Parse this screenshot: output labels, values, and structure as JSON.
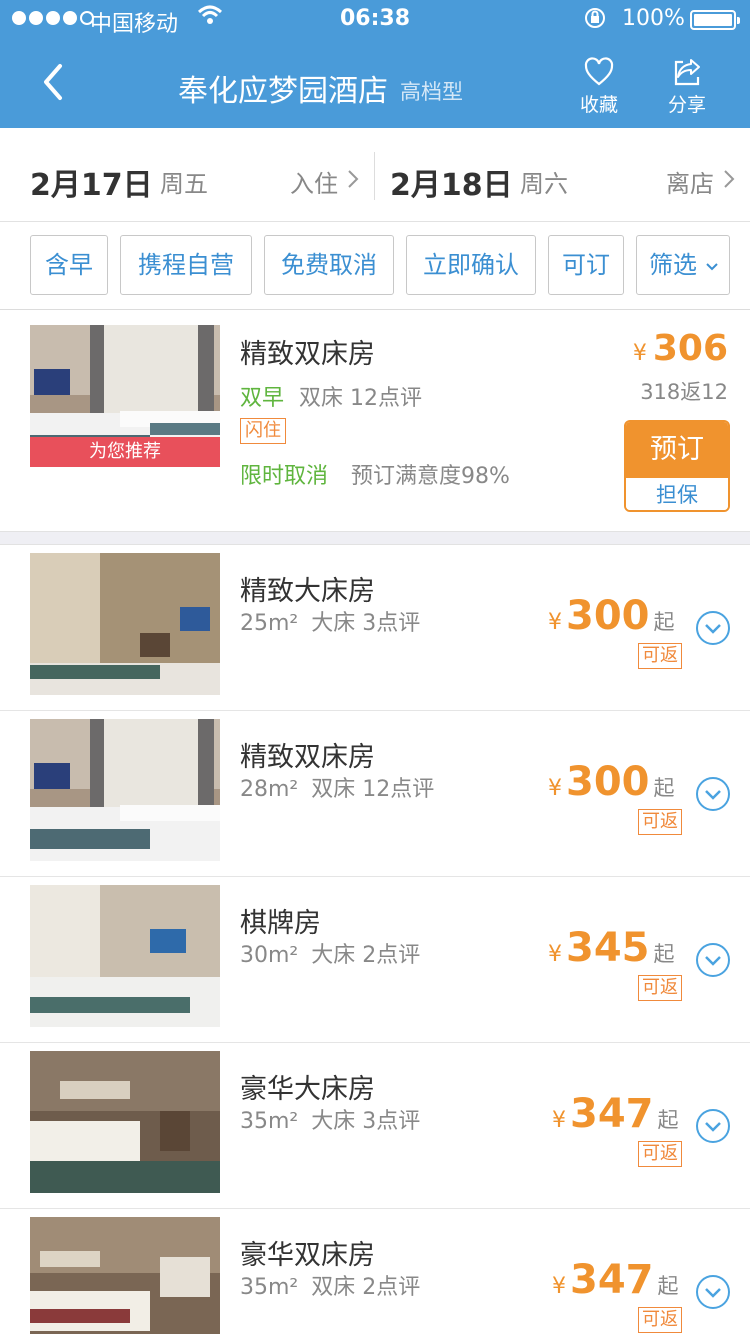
{
  "status": {
    "carrier": "中国移动",
    "time": "06:38",
    "battery": "100%"
  },
  "nav": {
    "title": "奉化应梦园酒店",
    "tag": "高档型",
    "favorite": "收藏",
    "share": "分享"
  },
  "dates": {
    "checkin_date": "2月17日",
    "checkin_week": "周五",
    "checkin_action": "入住",
    "checkout_date": "2月18日",
    "checkout_week": "周六",
    "checkout_action": "离店"
  },
  "filters": [
    "含早",
    "携程自营",
    "免费取消",
    "立即确认",
    "可订",
    "筛选"
  ],
  "featured": {
    "name": "精致双床房",
    "breakfast": "双早",
    "info": "双床 12点评",
    "flash": "闪住",
    "cancel": "限时取消",
    "satisfaction": "预订满意度98%",
    "yen": "¥",
    "price": "306",
    "cashback": "318返12",
    "book": "预订",
    "guarantee": "担保",
    "badge": "为您推荐"
  },
  "rooms": [
    {
      "name": "精致大床房",
      "area": "25m²",
      "info": "大床 3点评",
      "yen": "¥",
      "price": "300",
      "qi": "起",
      "fan": "可返"
    },
    {
      "name": "精致双床房",
      "area": "28m²",
      "info": "双床 12点评",
      "yen": "¥",
      "price": "300",
      "qi": "起",
      "fan": "可返"
    },
    {
      "name": "棋牌房",
      "area": "30m²",
      "info": "大床 2点评",
      "yen": "¥",
      "price": "345",
      "qi": "起",
      "fan": "可返"
    },
    {
      "name": "豪华大床房",
      "area": "35m²",
      "info": "大床 3点评",
      "yen": "¥",
      "price": "347",
      "qi": "起",
      "fan": "可返"
    },
    {
      "name": "豪华双床房",
      "area": "35m²",
      "info": "双床 2点评",
      "yen": "¥",
      "price": "347",
      "qi": "起",
      "fan": "可返"
    }
  ],
  "colors": {
    "nav_bg": "#4a9bd9",
    "accent_blue": "#3b8fd2",
    "price_orange": "#f0932e",
    "green": "#5fb53e",
    "badge_red": "#e8505b"
  }
}
